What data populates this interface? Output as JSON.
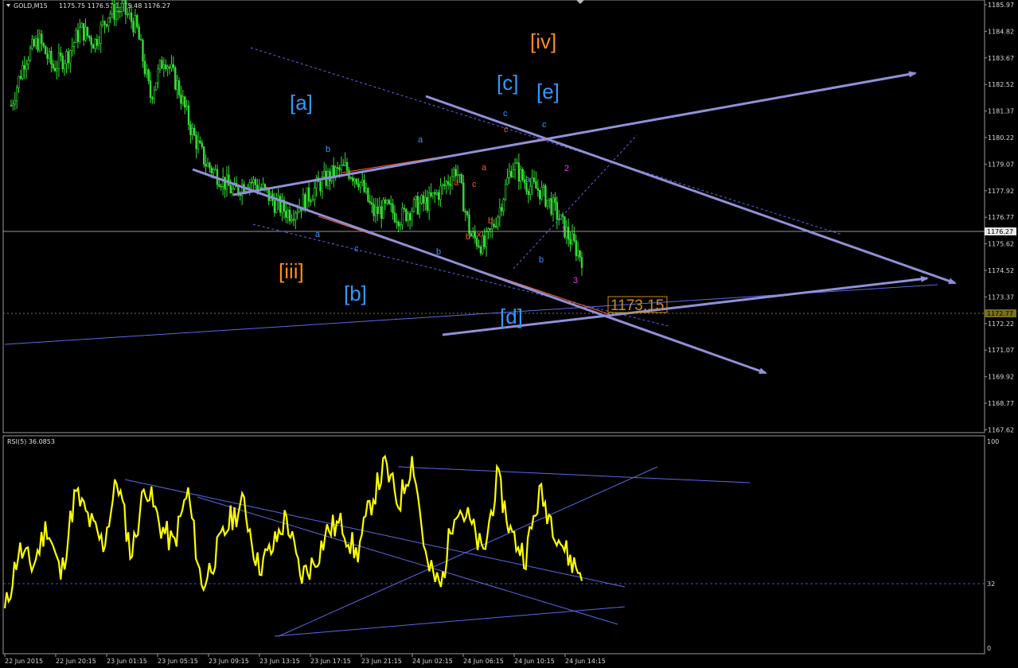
{
  "header": {
    "symbol": "GOLD,M15",
    "ohlc": "1175.75 1176.57 1175.48 1176.27"
  },
  "rsi_header": "RSI(5) 36.0853",
  "current_price": "1176.27",
  "dotted_level": "1172.77",
  "target_label": "1173.15",
  "price_axis": [
    "1185.97",
    "1184.82",
    "1183.67",
    "1182.52",
    "1181.37",
    "1180.22",
    "1179.07",
    "1177.92",
    "1176.77",
    "1175.62",
    "1174.52",
    "1173.37",
    "1172.22",
    "1171.07",
    "1169.92",
    "1168.77",
    "1167.62"
  ],
  "rsi_axis": {
    "top": "100",
    "level": "32",
    "bottom": "0"
  },
  "time_axis": [
    "22 Jun 2015",
    "22 Jun 20:15",
    "23 Jun 01:15",
    "23 Jun 05:15",
    "23 Jun 09:15",
    "23 Jun 13:15",
    "23 Jun 17:15",
    "23 Jun 21:15",
    "24 Jun 02:15",
    "24 Jun 06:15",
    "24 Jun 10:15",
    "24 Jun 14:15"
  ],
  "wave_labels_big": [
    {
      "text": "[iv]",
      "color": "#ff8c1a"
    },
    {
      "text": "[c]",
      "color": "#3399ff"
    },
    {
      "text": "[e]",
      "color": "#3399ff"
    },
    {
      "text": "[a]",
      "color": "#3399ff"
    },
    {
      "text": "[iii]",
      "color": "#ff8c1a"
    },
    {
      "text": "[b]",
      "color": "#3399ff"
    },
    {
      "text": "[d]",
      "color": "#3399ff"
    }
  ],
  "wave_labels_small": [
    {
      "text": "b",
      "color": "#3399ff"
    },
    {
      "text": "a",
      "color": "#3399ff"
    },
    {
      "text": "c",
      "color": "#3399ff"
    },
    {
      "text": "a",
      "color": "#3399ff"
    },
    {
      "text": "b",
      "color": "#3399ff"
    },
    {
      "text": "c",
      "color": "#3399ff"
    },
    {
      "text": "c",
      "color": "#ff5a1a"
    },
    {
      "text": "c",
      "color": "#3399ff"
    },
    {
      "text": "a",
      "color": "#3399ff"
    },
    {
      "text": "b",
      "color": "#3399ff"
    },
    {
      "text": "a",
      "color": "#ff5a1a"
    },
    {
      "text": "a",
      "color": "#ff5a1a"
    },
    {
      "text": "c",
      "color": "#ff5a1a"
    },
    {
      "text": "b",
      "color": "#ff5a1a"
    },
    {
      "text": "b",
      "color": "#ff5a1a"
    },
    {
      "text": "x",
      "color": "#ff5a1a"
    },
    {
      "text": "2",
      "color": "#e040e0"
    },
    {
      "text": "1",
      "color": "#e040e0"
    },
    {
      "text": "3",
      "color": "#e040e0"
    }
  ],
  "colors": {
    "bg": "#000000",
    "candles": "#33dd33",
    "trend": "#9090d8",
    "thin": "#5060ff",
    "rsi": "#ffff00",
    "grid": "#9a9a9a",
    "target": "#c89018"
  },
  "chart_data": [
    {
      "type": "candlestick",
      "title": "GOLD,M15",
      "ylim": [
        1167.2,
        1186.5
      ],
      "close_path": [
        1181.8,
        1183.9,
        1184.7,
        1183.5,
        1184.0,
        1185.2,
        1184.6,
        1185.9,
        1186.1,
        1185.3,
        1182.2,
        1184.0,
        1182.6,
        1180.6,
        1179.2,
        1178.6,
        1177.9,
        1178.5,
        1178.1,
        1177.4,
        1177.0,
        1177.5,
        1178.2,
        1178.7,
        1179.0,
        1178.5,
        1177.0,
        1177.2,
        1176.8,
        1177.3,
        1177.5,
        1178.1,
        1179.0,
        1176.0,
        1175.5,
        1177.0,
        1179.2,
        1178.3,
        1178.0,
        1177.2,
        1176.0,
        1175.0
      ],
      "annotation": "1173.15"
    },
    {
      "type": "line",
      "title": "RSI(5) 36.0853",
      "ylim": [
        0,
        100
      ],
      "level": 32,
      "values": [
        18,
        48,
        40,
        60,
        35,
        75,
        62,
        50,
        82,
        45,
        80,
        60,
        50,
        76,
        30,
        46,
        62,
        70,
        40,
        48,
        64,
        35,
        42,
        58,
        60,
        45,
        70,
        88,
        70,
        92,
        40,
        30,
        70,
        62,
        45,
        82,
        55,
        45,
        75,
        60,
        45,
        36
      ]
    }
  ]
}
